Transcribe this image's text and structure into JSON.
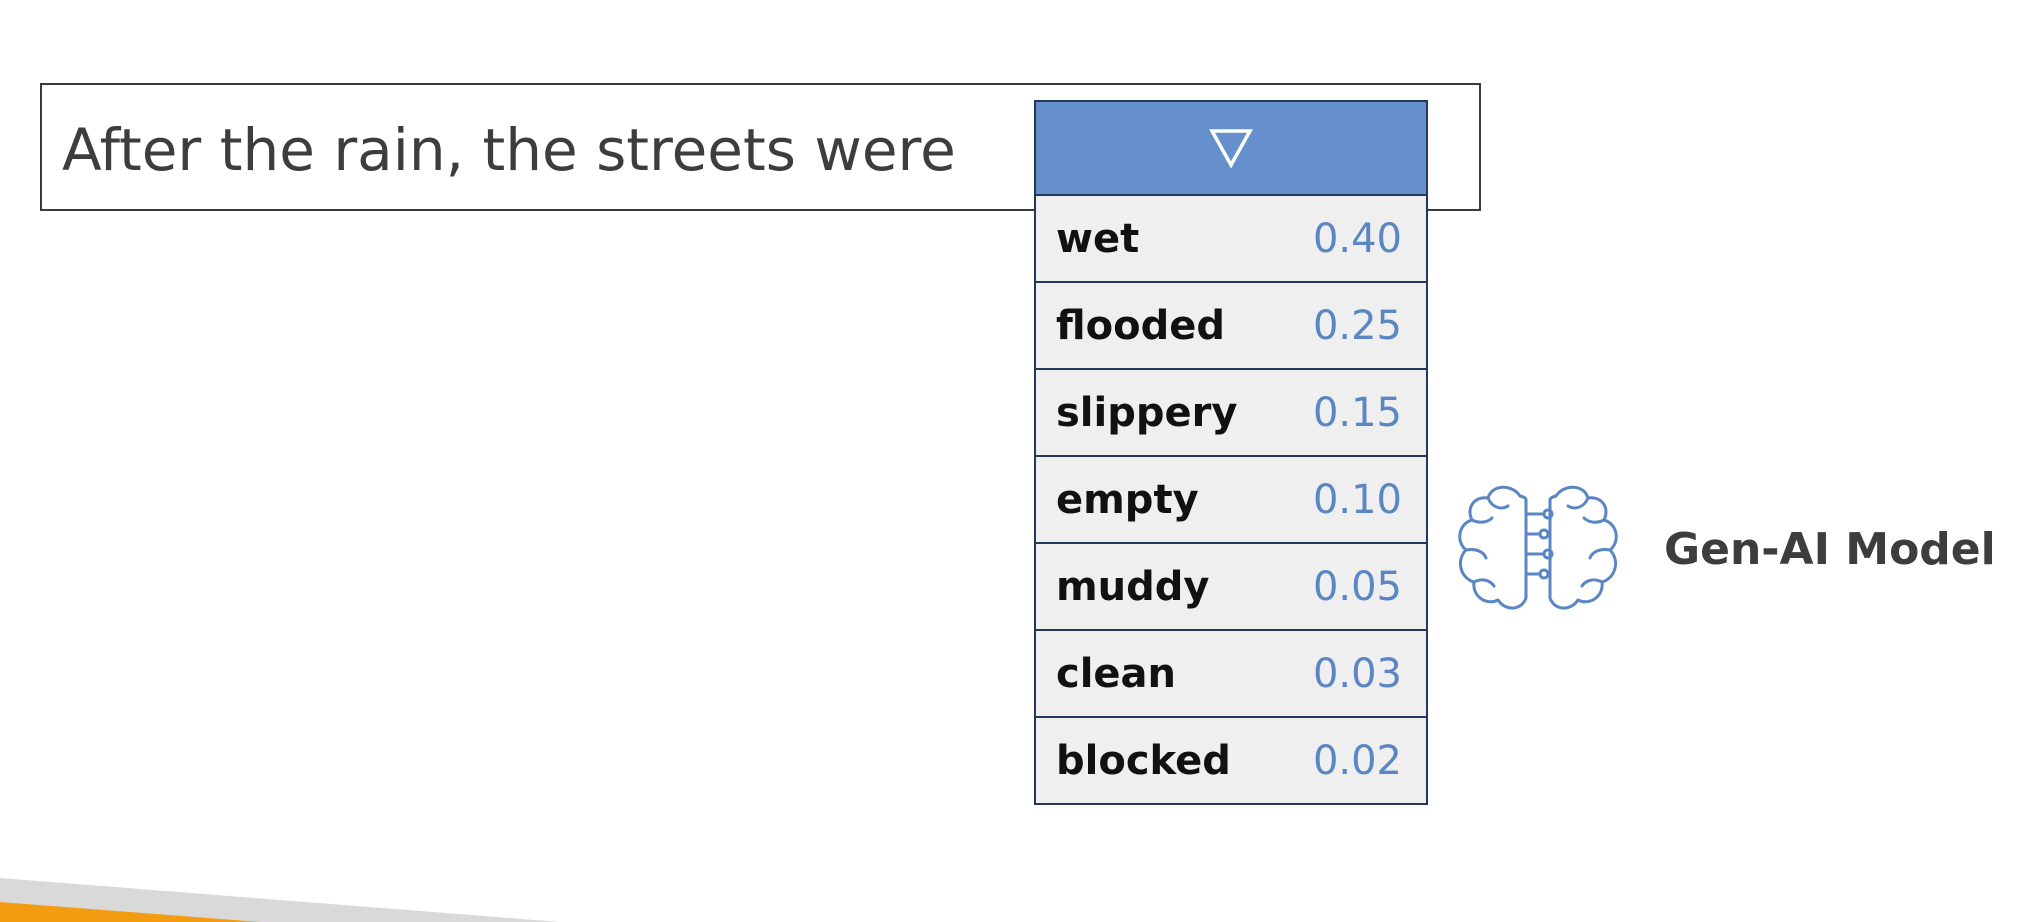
{
  "prompt": {
    "text": "After the rain, the streets were"
  },
  "dropdown": {
    "toggle_icon": "triangle-down-outline-icon",
    "header_color": "#6590cb",
    "options": [
      {
        "word": "wet",
        "prob": "0.40"
      },
      {
        "word": "flooded",
        "prob": "0.25"
      },
      {
        "word": "slippery",
        "prob": "0.15"
      },
      {
        "word": "empty",
        "prob": "0.10"
      },
      {
        "word": "muddy",
        "prob": "0.05"
      },
      {
        "word": "clean",
        "prob": "0.03"
      },
      {
        "word": "blocked",
        "prob": "0.02"
      }
    ]
  },
  "model": {
    "icon": "brain-circuit-icon",
    "label": "Gen-AI Model"
  },
  "colors": {
    "probability_text": "#5b86c4",
    "border": "#24395a",
    "footer_orange": "#f39c12",
    "footer_gray": "#d9d9d9"
  }
}
